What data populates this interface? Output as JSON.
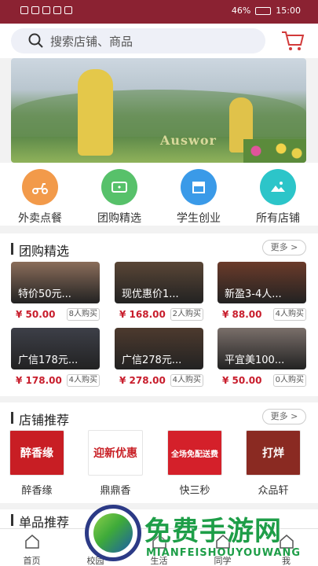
{
  "status_bar": {
    "battery": "46%",
    "time": "15:00"
  },
  "search": {
    "placeholder": "搜索店铺、商品"
  },
  "banner": {
    "sign_text": "Auswor"
  },
  "categories": [
    {
      "label": "外卖点餐",
      "icon": "scooter-icon",
      "color": "#f29a4a"
    },
    {
      "label": "团购精选",
      "icon": "ticket-icon",
      "color": "#57c16a"
    },
    {
      "label": "学生创业",
      "icon": "store-icon",
      "color": "#3a9ae8"
    },
    {
      "label": "所有店铺",
      "icon": "mountain-icon",
      "color": "#2cc5c9"
    }
  ],
  "group_buy": {
    "title": "团购精选",
    "more": "更多 >",
    "items": [
      {
        "title": "特价50元...",
        "price": "¥ 50.00",
        "buyers": "8人购买",
        "color": "#8a6d5a"
      },
      {
        "title": "现优惠价1...",
        "price": "¥ 168.00",
        "buyers": "2人购买",
        "color": "#5a4636"
      },
      {
        "title": "新盈3-4人...",
        "price": "¥ 88.00",
        "buyers": "4人购买",
        "color": "#6b3b2a"
      },
      {
        "title": "广信178元...",
        "price": "¥ 178.00",
        "buyers": "4人购买",
        "color": "#3d3f48"
      },
      {
        "title": "广信278元...",
        "price": "¥ 278.00",
        "buyers": "4人购买",
        "color": "#4d3a2e"
      },
      {
        "title": "平宜美100...",
        "price": "¥ 50.00",
        "buyers": "0人购买",
        "color": "#7a6f6a"
      }
    ]
  },
  "shops": {
    "title": "店铺推荐",
    "more": "更多 >",
    "items": [
      {
        "name": "醉香缘",
        "logo_text": "醉香缘",
        "bg": "#c81e24",
        "fg": "#fff"
      },
      {
        "name": "鼎鼎香",
        "logo_text": "迎新优惠",
        "bg": "#ffffff",
        "fg": "#c81e24"
      },
      {
        "name": "快三秒",
        "logo_text": "全场免配送费",
        "bg": "#d4202a",
        "fg": "#fff"
      },
      {
        "name": "众品轩",
        "logo_text": "打烊",
        "bg": "#8a2a22",
        "fg": "#fff"
      }
    ]
  },
  "singles": {
    "title": "单品推荐"
  },
  "tabs": [
    {
      "label": "首页",
      "icon": "home-icon"
    },
    {
      "label": "校园",
      "icon": "campus-icon"
    },
    {
      "label": "生活",
      "icon": "life-icon"
    },
    {
      "label": "同学",
      "icon": "classmates-icon"
    },
    {
      "label": "我",
      "icon": "user-icon"
    }
  ],
  "watermark": {
    "title": "免费手游网",
    "subtitle": "MIANFEISHOUYOUWANG"
  }
}
